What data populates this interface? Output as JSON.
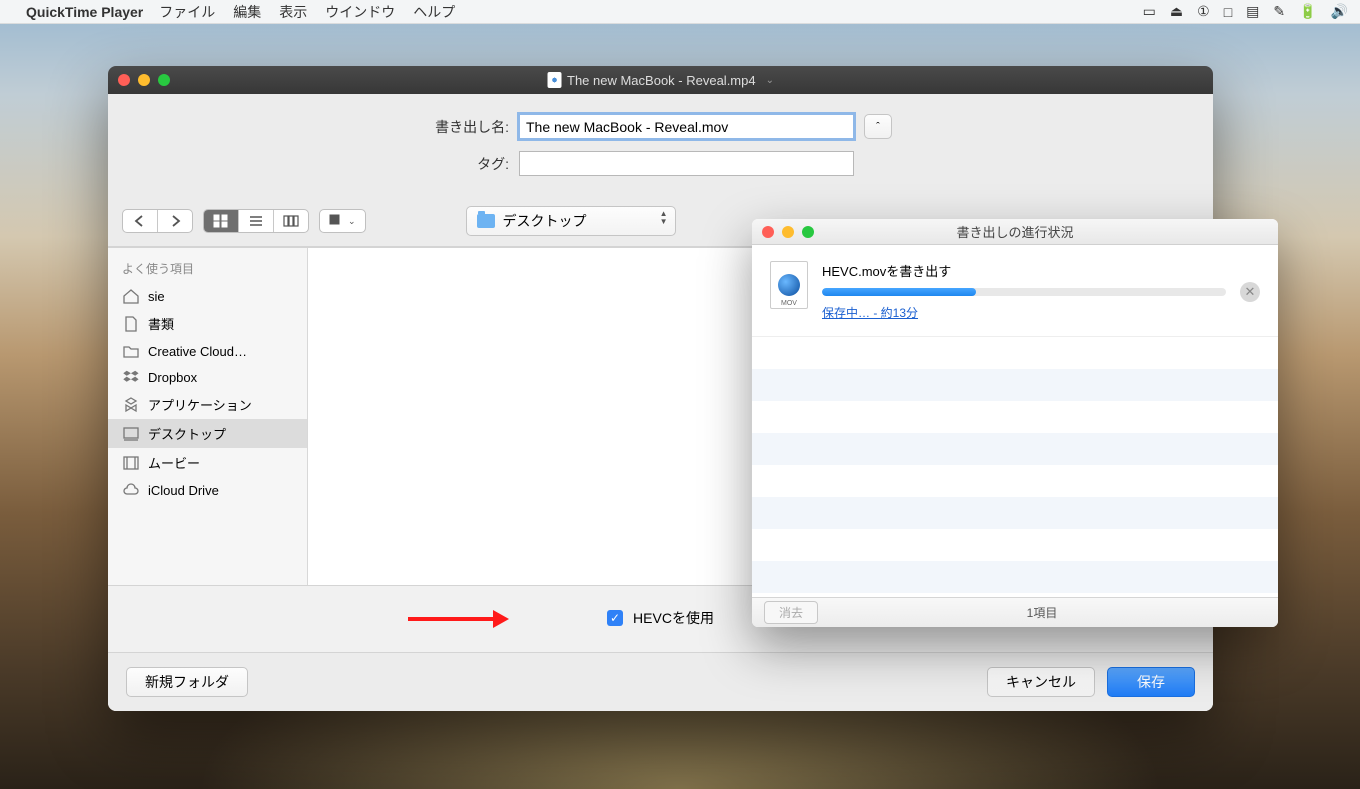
{
  "menubar": {
    "app_name": "QuickTime Player",
    "items": [
      "ファイル",
      "編集",
      "表示",
      "ウインドウ",
      "ヘルプ"
    ]
  },
  "window": {
    "title": "The new MacBook - Reveal.mp4",
    "export_name_label": "書き出し名:",
    "export_name_value": "The new MacBook - Reveal.mov",
    "tags_label": "タグ:",
    "tags_value": "",
    "location_label": "デスクトップ",
    "sidebar_header": "よく使う項目",
    "sidebar_items": [
      {
        "label": "sie",
        "icon": "home"
      },
      {
        "label": "書類",
        "icon": "doc"
      },
      {
        "label": "Creative Cloud…",
        "icon": "folder"
      },
      {
        "label": "Dropbox",
        "icon": "dropbox"
      },
      {
        "label": "アプリケーション",
        "icon": "app"
      },
      {
        "label": "デスクトップ",
        "icon": "desktop",
        "selected": true
      },
      {
        "label": "ムービー",
        "icon": "movie"
      },
      {
        "label": "iCloud Drive",
        "icon": "cloud"
      }
    ],
    "hevc_label": "HEVCを使用",
    "hevc_checked": true,
    "new_folder_label": "新規フォルダ",
    "cancel_label": "キャンセル",
    "save_label": "保存"
  },
  "progress": {
    "title": "書き出しの進行状況",
    "item_name": "HEVC.movを書き出す",
    "status_link": "保存中… - 約13分",
    "percent": 38,
    "clear_label": "消去",
    "count_label": "1項目"
  }
}
